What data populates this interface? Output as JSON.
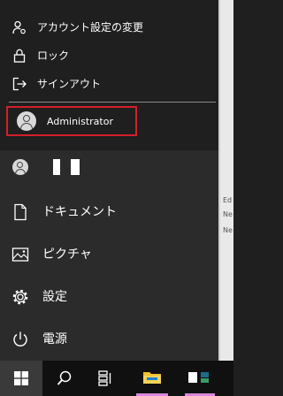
{
  "account_flyout": {
    "change_account_settings": "アカウント設定の変更",
    "lock": "ロック",
    "sign_out": "サインアウト",
    "other_user": "Administrator"
  },
  "start_menu": {
    "documents": "ドキュメント",
    "pictures": "ピクチャ",
    "settings": "設定",
    "power": "電源"
  },
  "desktop_fragments": [
    "Ed",
    "Ne",
    "Ne"
  ],
  "colors": {
    "highlight_border": "#d21f2a",
    "flyout_bg": "#1f1f1f",
    "menu_bg": "#2b2b2b",
    "taskbar_bg": "#101010"
  },
  "icons": {
    "change_account_settings": "person-settings-icon",
    "lock": "lock-icon",
    "sign_out": "sign-out-icon",
    "documents": "document-icon",
    "pictures": "pictures-icon",
    "settings": "gear-icon",
    "power": "power-icon",
    "taskbar_start": "windows-logo-icon",
    "taskbar_search": "search-icon",
    "taskbar_task_view": "task-view-icon",
    "taskbar_explorer": "file-explorer-icon"
  }
}
